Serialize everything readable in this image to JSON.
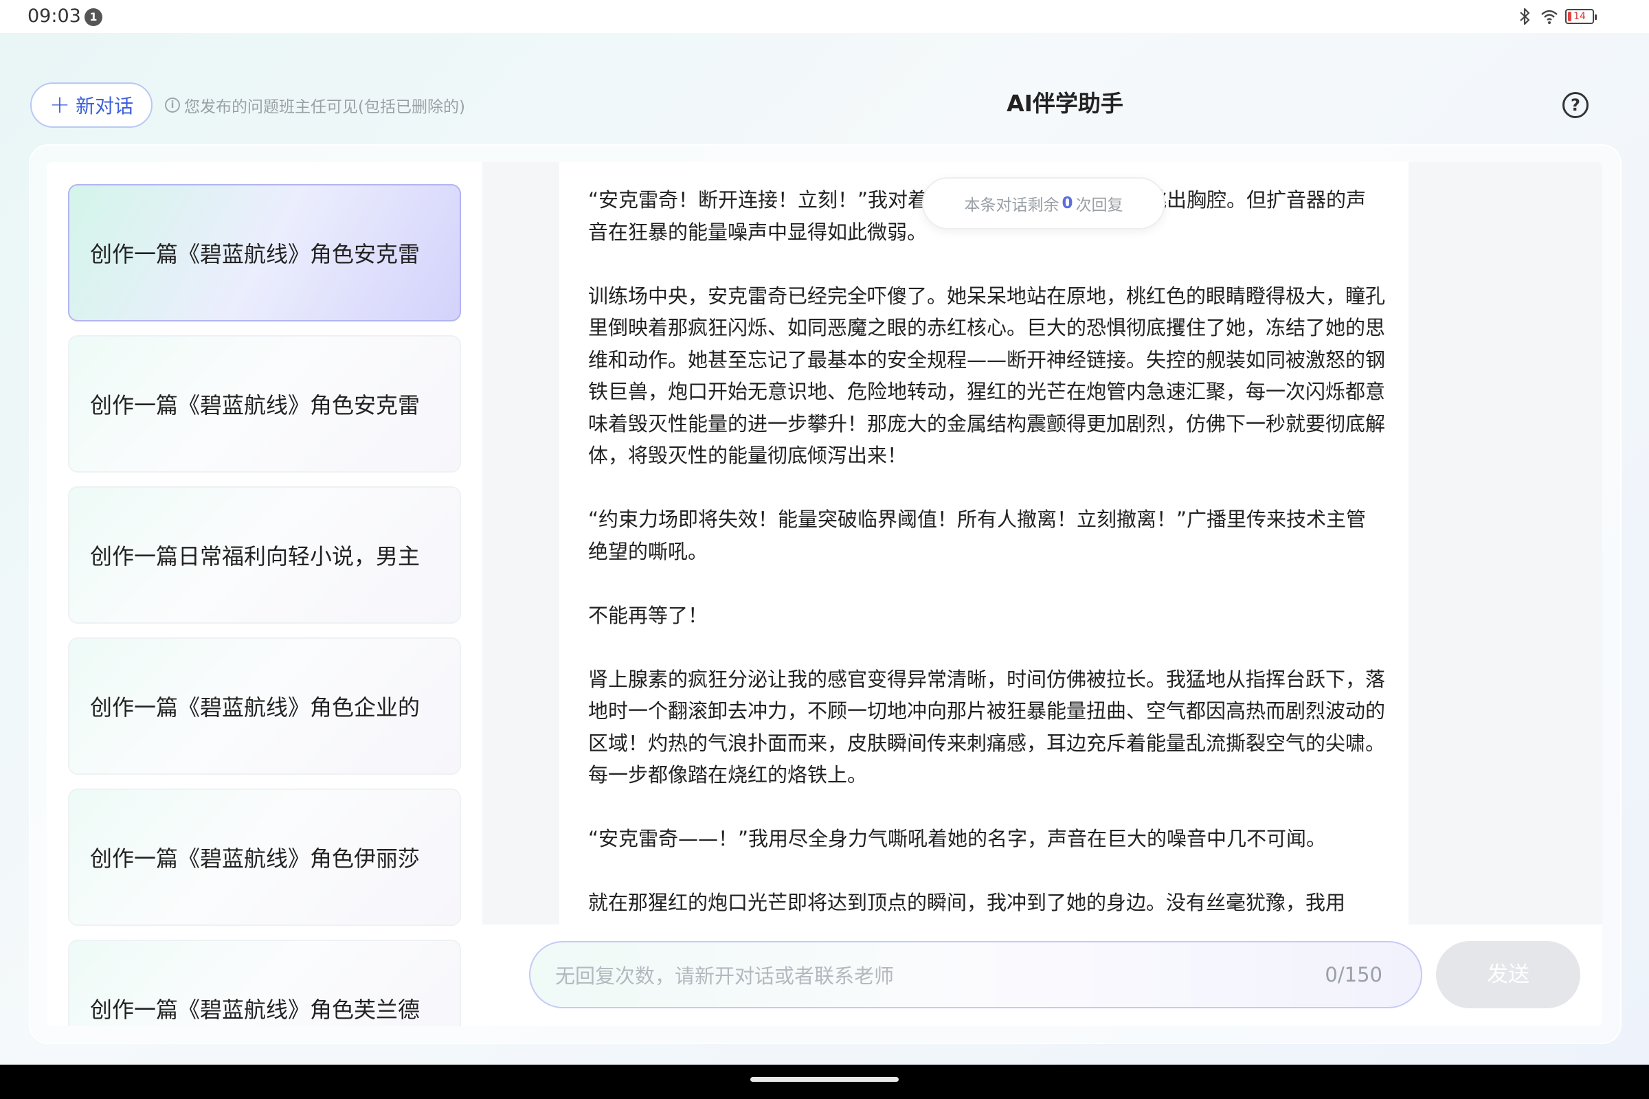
{
  "status_bar": {
    "time": "09:03",
    "notification_count": "1",
    "battery_level": "14",
    "icons": [
      "bluetooth-icon",
      "wifi-icon",
      "battery-icon"
    ]
  },
  "header": {
    "new_chat_label": "新对话",
    "notice": "您发布的问题班主任可见(包括已删除的)",
    "title": "AI伴学助手",
    "help_icon": "?"
  },
  "sidebar": {
    "items": [
      {
        "label": "创作一篇《碧蓝航线》角色安克雷",
        "active": true
      },
      {
        "label": "创作一篇《碧蓝航线》角色安克雷",
        "active": false
      },
      {
        "label": "创作一篇日常福利向轻小说，男主",
        "active": false
      },
      {
        "label": "创作一篇《碧蓝航线》角色企业的",
        "active": false
      },
      {
        "label": "创作一篇《碧蓝航线》角色伊丽莎",
        "active": false
      },
      {
        "label": "创作一篇《碧蓝航线》角色芙兰德",
        "active": false
      }
    ]
  },
  "remaining": {
    "prefix": "本条对话剩余",
    "count": "0",
    "suffix": "次回复"
  },
  "message": {
    "paragraphs": [
      "“安克雷奇！断开连接！立刻！”我对着扩音器嘶吼，心脏几乎要跳出胸腔。但扩音器的声音在狂暴的能量噪声中显得如此微弱。",
      "训练场中央，安克雷奇已经完全吓傻了。她呆呆地站在原地，桃红色的眼睛瞪得极大，瞳孔里倒映着那疯狂闪烁、如同恶魔之眼的赤红核心。巨大的恐惧彻底攫住了她，冻结了她的思维和动作。她甚至忘记了最基本的安全规程——断开神经链接。失控的舰装如同被激怒的钢铁巨兽，炮口开始无意识地、危险地转动，猩红的光芒在炮管内急速汇聚，每一次闪烁都意味着毁灭性能量的进一步攀升！那庞大的金属结构震颤得更加剧烈，仿佛下一秒就要彻底解体，将毁灭性的能量彻底倾泻出来！",
      "“约束力场即将失效！能量突破临界阈值！所有人撤离！立刻撤离！”广播里传来技术主管绝望的嘶吼。",
      "不能再等了！",
      "肾上腺素的疯狂分泌让我的感官变得异常清晰，时间仿佛被拉长。我猛地从指挥台跃下，落地时一个翻滚卸去冲力，不顾一切地冲向那片被狂暴能量扭曲、空气都因高热而剧烈波动的区域！灼热的气浪扑面而来，皮肤瞬间传来刺痛感，耳边充斥着能量乱流撕裂空气的尖啸。每一步都像踏在烧红的烙铁上。",
      "“安克雷奇——！”我用尽全身力气嘶吼着她的名字，声音在巨大的噪音中几不可闻。",
      "就在那猩红的炮口光芒即将达到顶点的瞬间，我冲到了她的身边。没有丝毫犹豫，我用"
    ]
  },
  "input": {
    "placeholder": "无回复次数，请新开对话或者联系老师",
    "value": "",
    "char_count": "0/150",
    "send_label": "发送"
  },
  "colors": {
    "accent": "#3d5fd9",
    "active_card_border": "#b3b4f4",
    "send_disabled": "#e4e6e9"
  }
}
